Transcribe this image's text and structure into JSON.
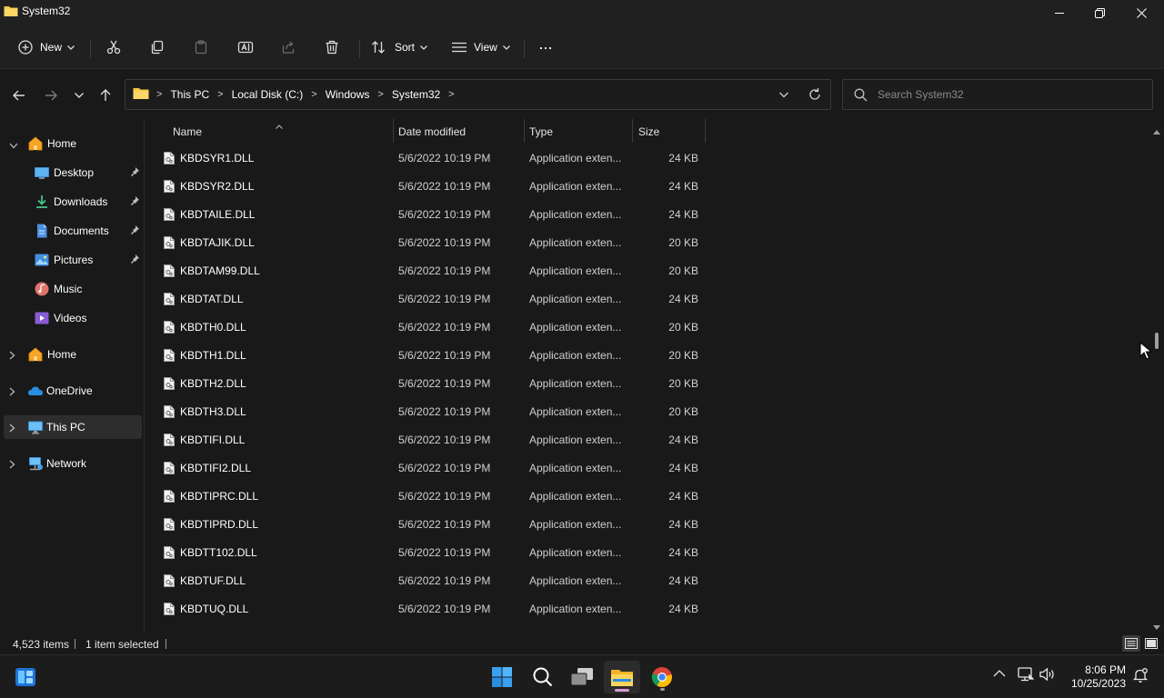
{
  "window": {
    "title": "System32"
  },
  "toolbar": {
    "new_label": "New",
    "sort_label": "Sort",
    "view_label": "View",
    "more_label": "···"
  },
  "address": {
    "segments": [
      "This PC",
      "Local Disk (C:)",
      "Windows",
      "System32"
    ]
  },
  "search": {
    "placeholder": "Search System32"
  },
  "sidebar": {
    "items": [
      {
        "label": "Home"
      },
      {
        "label": "Desktop"
      },
      {
        "label": "Downloads"
      },
      {
        "label": "Documents"
      },
      {
        "label": "Pictures"
      },
      {
        "label": "Music"
      },
      {
        "label": "Videos"
      },
      {
        "label": "Home"
      },
      {
        "label": "OneDrive"
      },
      {
        "label": "This PC"
      },
      {
        "label": "Network"
      }
    ]
  },
  "columns": {
    "name": "Name",
    "date": "Date modified",
    "type": "Type",
    "size": "Size"
  },
  "files": [
    {
      "name": "KBDSYR1.DLL",
      "date": "5/6/2022 10:19 PM",
      "type": "Application exten...",
      "size": "24 KB"
    },
    {
      "name": "KBDSYR2.DLL",
      "date": "5/6/2022 10:19 PM",
      "type": "Application exten...",
      "size": "24 KB"
    },
    {
      "name": "KBDTAILE.DLL",
      "date": "5/6/2022 10:19 PM",
      "type": "Application exten...",
      "size": "24 KB"
    },
    {
      "name": "KBDTAJIK.DLL",
      "date": "5/6/2022 10:19 PM",
      "type": "Application exten...",
      "size": "20 KB"
    },
    {
      "name": "KBDTAM99.DLL",
      "date": "5/6/2022 10:19 PM",
      "type": "Application exten...",
      "size": "20 KB"
    },
    {
      "name": "KBDTAT.DLL",
      "date": "5/6/2022 10:19 PM",
      "type": "Application exten...",
      "size": "24 KB"
    },
    {
      "name": "KBDTH0.DLL",
      "date": "5/6/2022 10:19 PM",
      "type": "Application exten...",
      "size": "20 KB"
    },
    {
      "name": "KBDTH1.DLL",
      "date": "5/6/2022 10:19 PM",
      "type": "Application exten...",
      "size": "20 KB"
    },
    {
      "name": "KBDTH2.DLL",
      "date": "5/6/2022 10:19 PM",
      "type": "Application exten...",
      "size": "20 KB"
    },
    {
      "name": "KBDTH3.DLL",
      "date": "5/6/2022 10:19 PM",
      "type": "Application exten...",
      "size": "20 KB"
    },
    {
      "name": "KBDTIFI.DLL",
      "date": "5/6/2022 10:19 PM",
      "type": "Application exten...",
      "size": "24 KB"
    },
    {
      "name": "KBDTIFI2.DLL",
      "date": "5/6/2022 10:19 PM",
      "type": "Application exten...",
      "size": "24 KB"
    },
    {
      "name": "KBDTIPRC.DLL",
      "date": "5/6/2022 10:19 PM",
      "type": "Application exten...",
      "size": "24 KB"
    },
    {
      "name": "KBDTIPRD.DLL",
      "date": "5/6/2022 10:19 PM",
      "type": "Application exten...",
      "size": "24 KB"
    },
    {
      "name": "KBDTT102.DLL",
      "date": "5/6/2022 10:19 PM",
      "type": "Application exten...",
      "size": "24 KB"
    },
    {
      "name": "KBDTUF.DLL",
      "date": "5/6/2022 10:19 PM",
      "type": "Application exten...",
      "size": "24 KB"
    },
    {
      "name": "KBDTUQ.DLL",
      "date": "5/6/2022 10:19 PM",
      "type": "Application exten...",
      "size": "24 KB"
    }
  ],
  "status": {
    "item_count": "4,523 items",
    "selection": "1 item selected"
  },
  "clock": {
    "time": "8:06 PM",
    "date": "10/25/2023"
  },
  "colors": {
    "background": "#191919",
    "chrome": "#202020",
    "selected": "#2d2d2d",
    "folder": "#f8c94a",
    "accent": "#0078d4"
  }
}
